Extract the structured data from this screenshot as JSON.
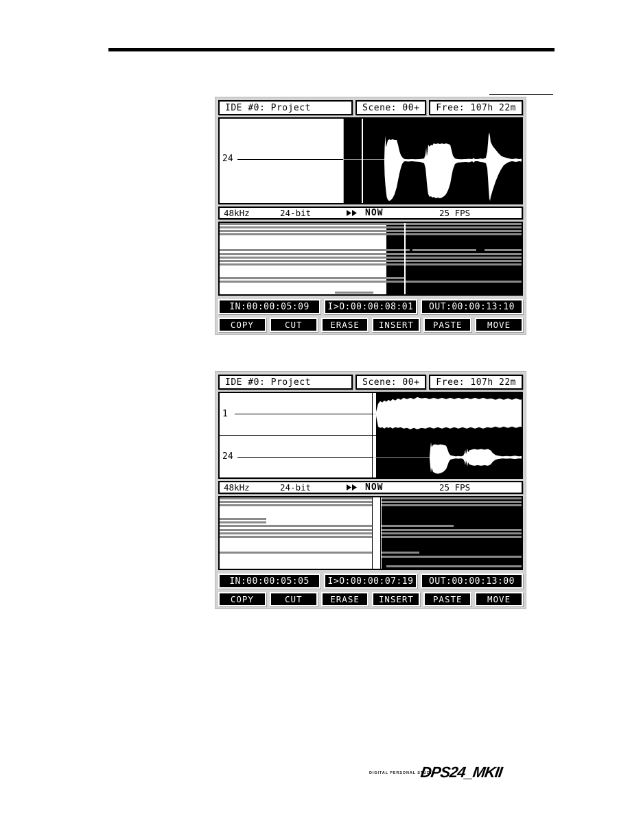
{
  "screens": [
    {
      "id": "screen-top",
      "header": {
        "ide": "IDE #0: Project",
        "scene": "Scene: 00+",
        "free": "Free: 107h 22m"
      },
      "tracks": [
        {
          "label": "24"
        }
      ],
      "info": {
        "sample_rate": "48kHz",
        "bit_depth": "24-bit",
        "transport_icon": "fast-forward-icon",
        "transport_label": "NOW",
        "frame_rate": "25 FPS"
      },
      "times": {
        "in": "IN:00:00:05:09",
        "io": "I>O:00:00:08:01",
        "out": "OUT:00:00:13:10"
      },
      "buttons": [
        "COPY",
        "CUT",
        "ERASE",
        "INSERT",
        "PASTE",
        "MOVE"
      ]
    },
    {
      "id": "screen-bottom",
      "header": {
        "ide": "IDE #0: Project",
        "scene": "Scene: 00+",
        "free": "Free: 107h 22m"
      },
      "tracks": [
        {
          "label": "1"
        },
        {
          "label": "24"
        }
      ],
      "info": {
        "sample_rate": "48kHz",
        "bit_depth": "24-bit",
        "transport_icon": "fast-forward-icon",
        "transport_label": "NOW",
        "frame_rate": "25 FPS"
      },
      "times": {
        "in": "IN:00:00:05:05",
        "io": "I>O:00:00:07:19",
        "out": "OUT:00:00:13:00"
      },
      "buttons": [
        "COPY",
        "CUT",
        "ERASE",
        "INSERT",
        "PASTE",
        "MOVE"
      ]
    }
  ],
  "footer": {
    "tagline": "DIGITAL PERSONAL STUDIO",
    "product": "DPS24_MKII"
  },
  "colors": {
    "lcd_bezel": "#d4d4d4",
    "lcd_ink": "#000000",
    "lcd_paper": "#ffffff",
    "region_grey": "#8a8a8a"
  }
}
